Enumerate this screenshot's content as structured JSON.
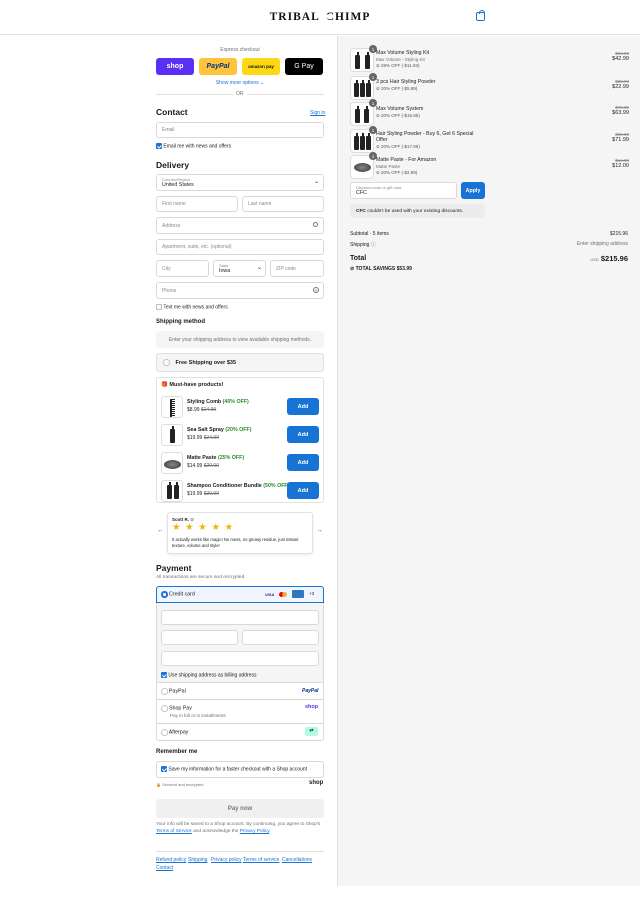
{
  "header": {
    "brand": "TRIBAL",
    "brand2": "CHIMP"
  },
  "express": {
    "title": "Express checkout",
    "shop": "shop",
    "paypal": "PayPal",
    "amazon": "amazon pay",
    "gpay": "G Pay",
    "more": "Show more options",
    "or": "OR"
  },
  "contact": {
    "title": "Contact",
    "signin": "Sign in",
    "email_placeholder": "Email",
    "news": "Email me with news and offers"
  },
  "delivery": {
    "title": "Delivery",
    "country_label": "Country/Region",
    "country_value": "United States",
    "first": "First name",
    "last": "Last name",
    "address": "Address",
    "apt": "Apartment, suite, etc. (optional)",
    "city": "City",
    "state_label": "State",
    "state_value": "Iowa",
    "zip": "ZIP code",
    "phone": "Phone",
    "sms": "Text me with news and offers"
  },
  "shipping": {
    "title": "Shipping method",
    "note": "Enter your shipping address to view available shipping methods.",
    "free": "Free Shipping over $35"
  },
  "upsell": {
    "title": "Must-have products!",
    "add": "Add",
    "items": [
      {
        "name": "Styling Comb",
        "off": "(40% OFF)",
        "price": "$8.99",
        "old": "$14.99"
      },
      {
        "name": "Sea Salt Spray",
        "off": "(20% OFF)",
        "price": "$19.99",
        "old": "$24.99"
      },
      {
        "name": "Matte Paste",
        "off": "(25% OFF)",
        "price": "$14.99",
        "old": "$20.00"
      },
      {
        "name": "Shampoo Conditioner Bundle",
        "off": "(50% OFF)",
        "price": "$19.99",
        "old": "$39.99"
      }
    ]
  },
  "review": {
    "author": "Scott R.",
    "stars": "★ ★ ★ ★ ★",
    "text": "It actually works like magic! No mess, no greasy residue, just instant texture, volume and style!"
  },
  "payment": {
    "title": "Payment",
    "subtitle": "All transactions are secure and encrypted.",
    "cc": "Credit card",
    "visa": "VISA",
    "more_cards": "+3",
    "billing": "Use shipping address as billing address",
    "paypal": "PayPal",
    "paypal_logo": "PayPal",
    "shoppay": "Shop Pay",
    "shoppay_sub": "Pay in full or in installments",
    "shoppay_logo": "shop",
    "afterpay": "Afterpay"
  },
  "remember": {
    "title": "Remember me",
    "save": "Save my information for a faster checkout with a Shop account",
    "secure": "Secured and encrypted",
    "shop": "shop"
  },
  "paynow": "Pay now",
  "legal": {
    "text1": "Your info will be saved to a Shop account. By continuing, you agree to Shop's",
    "terms": "Terms of Service",
    "and": "and acknowledge the",
    "privacy": "Privacy Policy",
    "dot": "."
  },
  "footer": [
    "Refund policy",
    "Shipping",
    "Privacy policy",
    "Terms of service",
    "Cancellations",
    "Contact"
  ],
  "order": {
    "items": [
      {
        "qty": "1",
        "name": "Max Volume Styling Kit",
        "sub": "Max Volume - Styling Kit",
        "disc": "28% OFF (-$11.93)",
        "old": "$54.93",
        "price": "$42.99"
      },
      {
        "qty": "1",
        "name": "3 pcs Hair Styling Powder",
        "sub": "",
        "disc": "20% OFF (-$5.99)",
        "old": "$28.99",
        "price": "$22.99"
      },
      {
        "qty": "1",
        "name": "Max Volume System",
        "sub": "",
        "disc": "20% OFF (-$15.95)",
        "old": "$79.95",
        "price": "$63.99"
      },
      {
        "qty": "1",
        "name": "Hair Styling Powder - Buy 6, Get 6 Special Offer",
        "sub": "",
        "disc": "20% OFF (-$17.99)",
        "old": "$89.98",
        "price": "$71.99"
      },
      {
        "qty": "1",
        "name": "Matte Paste - For Amazon",
        "sub": "Matte Paste",
        "disc": "20% OFF (-$2.99)",
        "old": "$14.99",
        "price": "$12.00"
      }
    ],
    "discount_label": "Discount code or gift card",
    "discount_value": "CFC",
    "apply": "Apply",
    "error_code": "CFC",
    "error": "couldn't be used with your existing discounts.",
    "subtotal_label": "Subtotal · 5 items",
    "subtotal": "$215.96",
    "shipping_label": "Shipping",
    "shipping": "Enter shipping address",
    "total_label": "Total",
    "currency": "USD",
    "total": "$215.96",
    "savings_label": "TOTAL SAVINGS",
    "savings": "$53.99"
  }
}
